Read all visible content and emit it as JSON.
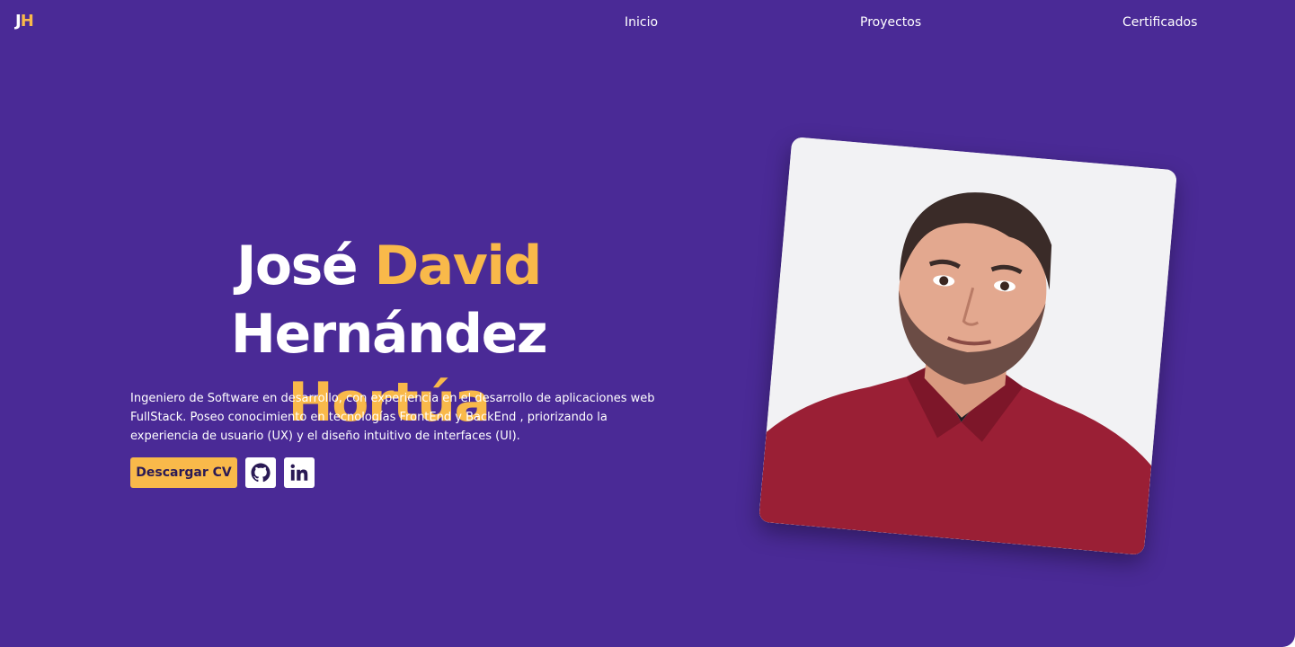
{
  "logo": {
    "part1": "J",
    "part2": "H"
  },
  "nav": {
    "inicio": "Inicio",
    "proyectos": "Proyectos",
    "certificados": "Certificados"
  },
  "hero": {
    "name_w1": "José",
    "name_w2": "David",
    "name_w3": "Hernández",
    "name_w4": "Hortúa",
    "description": "Ingeniero de Software en desarrollo, con experiencia en el desarrollo de aplicaciones web FullStack. Poseo conocimiento en tecnologías FrontEnd y BackEnd , priorizando la experiencia de usuario (UX) y el diseño intuitivo de interfaces (UI).",
    "cv_button": "Descargar CV"
  },
  "icons": {
    "github": "github-icon",
    "linkedin": "linkedin-icon"
  },
  "colors": {
    "background": "#4a2a96",
    "accent": "#f9b94a",
    "text": "#ffffff",
    "shirt": "#9a1f35"
  }
}
